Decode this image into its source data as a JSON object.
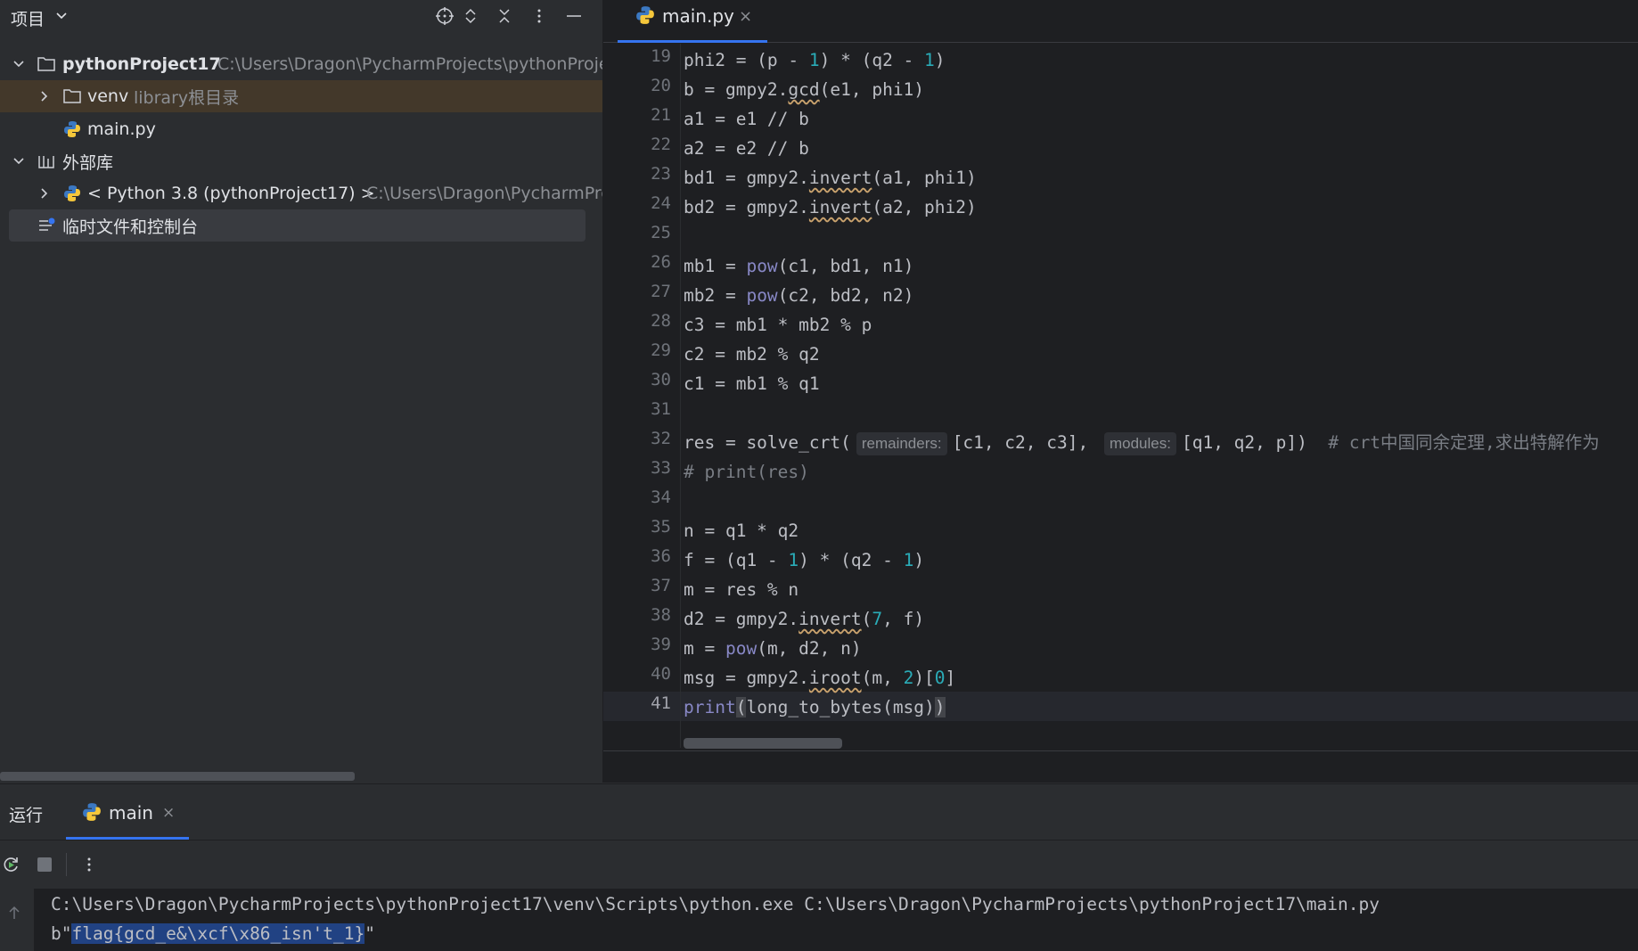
{
  "project_panel": {
    "title": "项目",
    "tree": {
      "root_name": "pythonProject17",
      "root_path": "C:\\Users\\Dragon\\PycharmProjects\\pythonProje",
      "venv_name": "venv",
      "venv_hint": "library根目录",
      "main_file": "main.py",
      "external_libs": "外部库",
      "python_sdk": "< Python 3.8 (pythonProject17) >",
      "python_sdk_path": "C:\\Users\\Dragon\\PycharmPro",
      "scratches": "临时文件和控制台"
    }
  },
  "editor": {
    "tab_label": "main.py",
    "tab_close": "×",
    "line_numbers": [
      "19",
      "20",
      "21",
      "22",
      "23",
      "24",
      "25",
      "26",
      "27",
      "28",
      "29",
      "30",
      "31",
      "32",
      "33",
      "34",
      "35",
      "36",
      "37",
      "38",
      "39",
      "40",
      "41"
    ],
    "hints": {
      "remainders": "remainders:",
      "modules": "modules:"
    }
  },
  "run_panel": {
    "title": "运行",
    "tab_label": "main",
    "tab_close": "×",
    "console": {
      "command": "C:\\Users\\Dragon\\PycharmProjects\\pythonProject17\\venv\\Scripts\\python.exe C:\\Users\\Dragon\\PycharmProjects\\pythonProject17\\main.py",
      "output_prefix": "b\"",
      "output_selected": "flag{gcd_e&\\xcf\\x86_isn't_1}",
      "output_suffix": "\""
    }
  },
  "colors": {
    "accent": "#3574f0",
    "number": "#2aacb8",
    "builtin": "#8888c6",
    "comment": "#7a7e85"
  },
  "icons": [
    "chevron-down-icon",
    "crosshair-icon",
    "expand-icon",
    "collapse-icon",
    "more-vertical-icon",
    "minimize-icon",
    "folder-icon",
    "python-file-icon",
    "library-icon",
    "scratches-icon",
    "rerun-icon",
    "stop-icon"
  ]
}
